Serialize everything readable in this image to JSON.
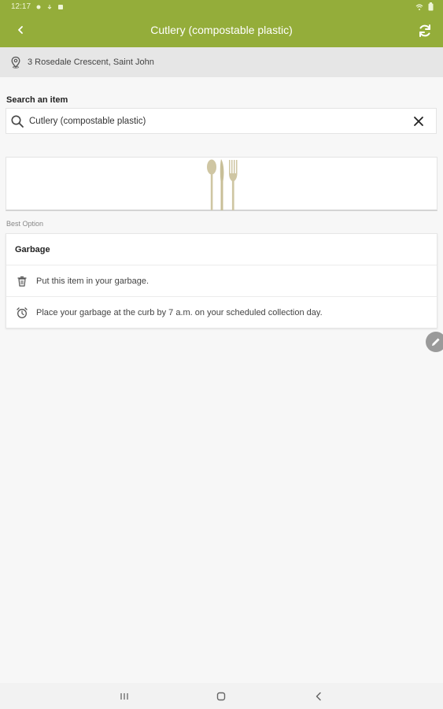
{
  "status_bar": {
    "time": "12:17"
  },
  "app_bar": {
    "title": "Cutlery (compostable plastic)"
  },
  "address": {
    "text": "3 Rosedale Crescent, Saint John"
  },
  "search": {
    "label": "Search an item",
    "value": "Cutlery (compostable plastic)"
  },
  "best_option": {
    "label": "Best Option"
  },
  "result_card": {
    "heading": "Garbage",
    "items": [
      {
        "icon": "trash-can-icon",
        "text": "Put this item in your garbage."
      },
      {
        "icon": "alarm-clock-icon",
        "text": "Place your garbage at the curb by 7 a.m. on your scheduled collection day."
      }
    ]
  },
  "colors": {
    "brand": "#94ad3a",
    "cutlery": "#c9bf98"
  }
}
